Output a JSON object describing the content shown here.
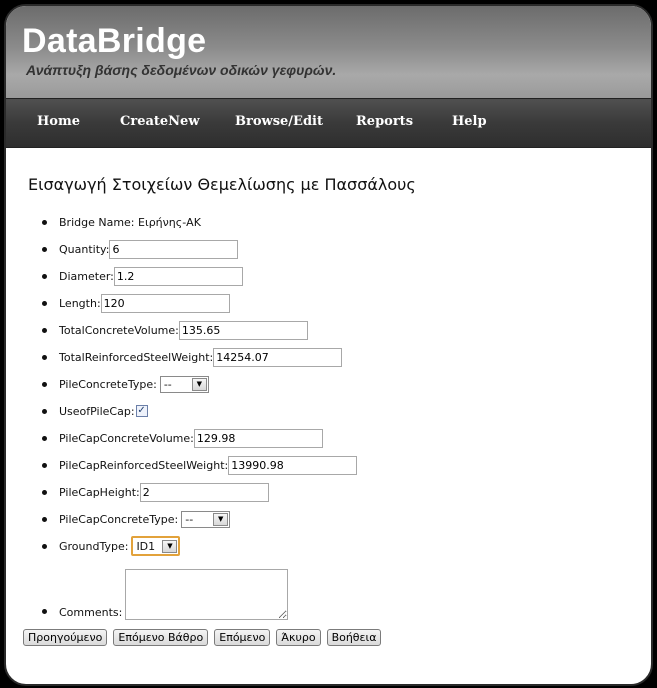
{
  "header": {
    "title": "DataBridge",
    "subtitle": "Ανάπτυξη βάσης δεδομένων οδικών γεφυρών."
  },
  "nav": {
    "items": [
      "Home",
      "CreateNew",
      "Browse/Edit",
      "Reports",
      "Help"
    ]
  },
  "page": {
    "title": "Εισαγωγή Στοιχείων Θεμελίωσης με Πασσάλους"
  },
  "form": {
    "bridge_name_label": "Bridge Name:",
    "bridge_name_value": "Ειρήνης-ΑΚ",
    "quantity_label": "Quantity:",
    "quantity_value": "6",
    "diameter_label": "Diameter:",
    "diameter_value": "1.2",
    "length_label": "Length:",
    "length_value": "120",
    "total_concrete_volume_label": "TotalConcreteVolume:",
    "total_concrete_volume_value": "135.65",
    "total_reinforced_steel_weight_label": "TotalReinforcedSteelWeight:",
    "total_reinforced_steel_weight_value": "14254.07",
    "pile_concrete_type_label": "PileConcreteType:",
    "pile_concrete_type_value": "--",
    "use_of_pile_cap_label": "UseofPileCap:",
    "use_of_pile_cap_checked": true,
    "pile_cap_concrete_volume_label": "PileCapConcreteVolume:",
    "pile_cap_concrete_volume_value": "129.98",
    "pile_cap_reinforced_steel_weight_label": "PileCapReinforcedSteelWeight:",
    "pile_cap_reinforced_steel_weight_value": "13990.98",
    "pile_cap_height_label": "PileCapHeight:",
    "pile_cap_height_value": "2",
    "pile_cap_concrete_type_label": "PileCapConcreteType:",
    "pile_cap_concrete_type_value": "--",
    "ground_type_label": "GroundType:",
    "ground_type_value": "ID1",
    "comments_label": "Comments:",
    "comments_value": ""
  },
  "buttons": {
    "previous": "Προηγούμενο",
    "next_step": "Επόμενο Βάθρο",
    "next": "Επόμενο",
    "cancel": "Άκυρο",
    "help": "Βοήθεια"
  },
  "icons": {
    "checkbox_check": "check-icon",
    "select_arrow": "triangle-down-icon"
  },
  "colors": {
    "focus_ring": "#e2a23b",
    "nav_bg": "#3a3a3a",
    "header_bg": "#8b8b8b"
  }
}
